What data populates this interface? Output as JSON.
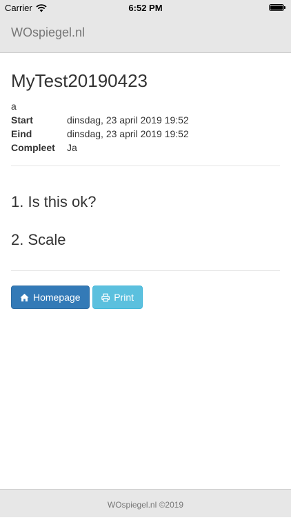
{
  "status_bar": {
    "carrier": "Carrier",
    "time": "6:52 PM"
  },
  "navbar": {
    "brand": "WOspiegel.nl"
  },
  "page": {
    "title": "MyTest20190423",
    "description": "a",
    "details": [
      {
        "label": "Start",
        "value": "dinsdag, 23 april 2019 19:52"
      },
      {
        "label": "Eind",
        "value": "dinsdag, 23 april 2019 19:52"
      },
      {
        "label": "Compleet",
        "value": "Ja"
      }
    ],
    "questions": [
      "1. Is this ok?",
      "2. Scale"
    ]
  },
  "buttons": {
    "homepage_label": "Homepage",
    "print_label": "Print"
  },
  "footer": {
    "text": "WOspiegel.nl ©2019"
  },
  "icons": {
    "homepage": "home-icon",
    "print": "print-icon"
  },
  "colors": {
    "primary": "#337ab7",
    "info": "#5bc0de",
    "navbar_bg": "#e7e7e7"
  }
}
